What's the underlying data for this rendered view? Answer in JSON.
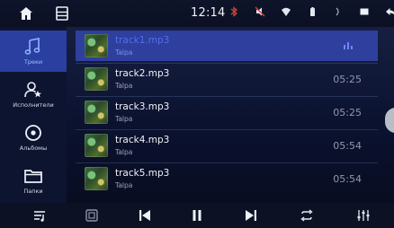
{
  "status_bar": {
    "time": "12:14",
    "icons": [
      "home-icon",
      "menu-icon",
      "bluetooth-icon",
      "mute-icon",
      "wifi-icon",
      "battery-icon",
      "signal-icon",
      "window-icon",
      "back-icon"
    ]
  },
  "sidebar": {
    "items": [
      {
        "label": "Треки",
        "icon": "music-note-icon",
        "active": true
      },
      {
        "label": "Исполнители",
        "icon": "artist-icon",
        "active": false
      },
      {
        "label": "Альбомы",
        "icon": "album-icon",
        "active": false
      },
      {
        "label": "Папки",
        "icon": "folder-icon",
        "active": false
      }
    ]
  },
  "tracks": [
    {
      "title": "track1.mp3",
      "artist": "Talpa",
      "duration": "",
      "active": true
    },
    {
      "title": "track2.mp3",
      "artist": "Talpa",
      "duration": "05:25",
      "active": false
    },
    {
      "title": "track3.mp3",
      "artist": "Talpa",
      "duration": "05:25",
      "active": false
    },
    {
      "title": "track4.mp3",
      "artist": "Talpa",
      "duration": "05:54",
      "active": false
    },
    {
      "title": "track5.mp3",
      "artist": "Talpa",
      "duration": "05:54",
      "active": false
    }
  ],
  "controls": [
    "playlist-icon",
    "media-source-icon",
    "previous-icon",
    "pause-icon",
    "next-icon",
    "repeat-icon",
    "equalizer-icon"
  ],
  "colors": {
    "accent": "#2e3f9d",
    "sidebar_bg": "#0d1430",
    "status_bg": "#0e1429"
  }
}
